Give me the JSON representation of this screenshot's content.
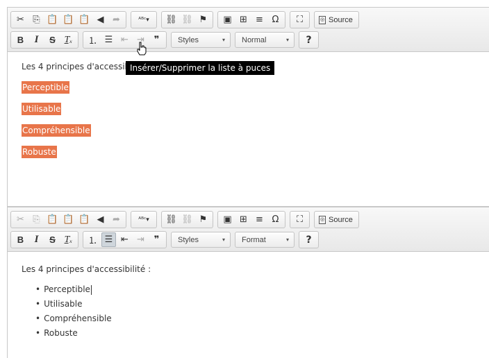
{
  "toolbar_top": {
    "clipboard": [
      "cut-icon",
      "copy-icon",
      "paste-icon",
      "paste-text-icon",
      "paste-word-icon",
      "undo-icon",
      "redo-icon"
    ],
    "spellcheck": "ABC",
    "source_label": "Source",
    "styles_label": "Styles",
    "help_label": "?"
  },
  "editor1": {
    "format_label": "Normal",
    "tooltip": "Insérer/Supprimer la liste à puces",
    "heading": "Les 4 principes d'accessibilité :",
    "items": [
      "Perceptible",
      "Utilisable",
      "Compréhensible",
      "Robuste"
    ]
  },
  "editor2": {
    "format_label": "Format",
    "heading": "Les 4 principes d'accessibilité :",
    "items": [
      "Perceptible",
      "Utilisable",
      "Compréhensible",
      "Robuste"
    ]
  },
  "colors": {
    "highlight": "#e8754a",
    "tooltip_bg": "#000000"
  }
}
